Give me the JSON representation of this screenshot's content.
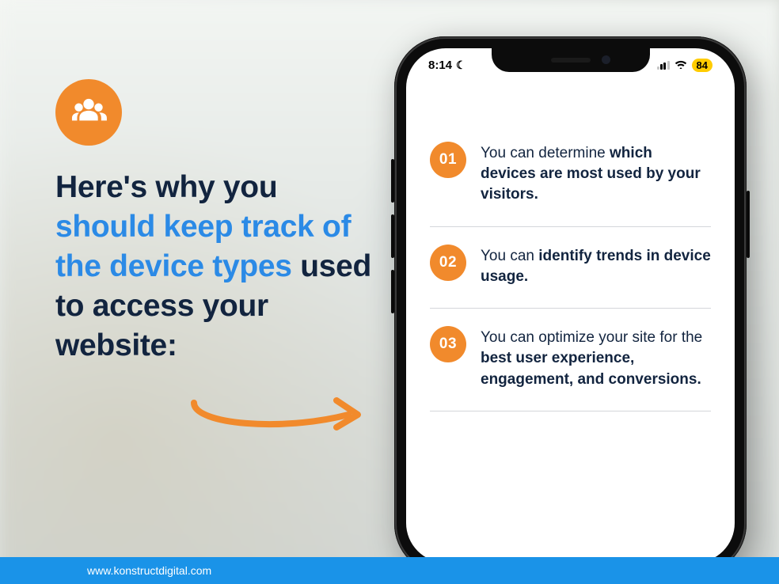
{
  "left_icon": "users-icon",
  "headline": {
    "part1": "Here's why you ",
    "accent": "should keep track of the device types",
    "part2": " used to access your website:"
  },
  "statusbar": {
    "time": "8:14",
    "battery": "84"
  },
  "items": [
    {
      "num": "01",
      "pre": "You can determine ",
      "bold": "which devices are most used by your visitors.",
      "post": ""
    },
    {
      "num": "02",
      "pre": "You can ",
      "bold": "identify trends in device usage.",
      "post": ""
    },
    {
      "num": "03",
      "pre": "You can optimize your site for the ",
      "bold": "best user experience, engagement, and conversions.",
      "post": ""
    }
  ],
  "footer_url": "www.konstructdigital.com"
}
